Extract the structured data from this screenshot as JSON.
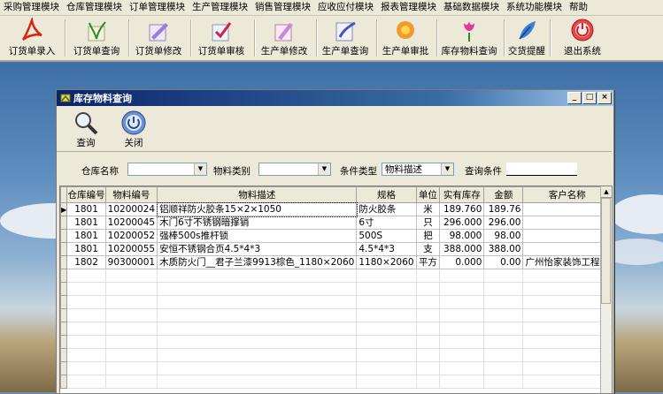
{
  "menu": [
    "采购管理模块",
    "仓库管理模块",
    "订单管理模块",
    "生产管理模块",
    "销售管理模块",
    "应收应付模块",
    "报表管理模块",
    "基础数据模块",
    "系统功能模块",
    "帮助"
  ],
  "toolbar": [
    {
      "label": "订货单录入",
      "icon": "pdf-icon"
    },
    {
      "label": "订货单查询",
      "icon": "plant-icon"
    },
    {
      "label": "订货单修改",
      "icon": "pen-icon"
    },
    {
      "label": "订货单审核",
      "icon": "check-icon"
    },
    {
      "label": "生产单修改",
      "icon": "edit-icon"
    },
    {
      "label": "生产单查询",
      "icon": "search-doc-icon"
    },
    {
      "label": "生产单审批",
      "icon": "flower-icon"
    },
    {
      "label": "库存物料查询",
      "icon": "tulip-icon"
    },
    {
      "label": "交货提醒",
      "icon": "feather-icon"
    },
    {
      "label": "退出系统",
      "icon": "exit-icon"
    }
  ],
  "window": {
    "title": "库存物料查询",
    "controls": [
      "_",
      "□",
      "×"
    ],
    "query_label": "查询",
    "close_label": "关闭"
  },
  "filter": {
    "warehouse_label": "仓库名称",
    "warehouse_value": "",
    "category_label": "物料类别",
    "category_value": "",
    "condtype_label": "条件类型",
    "condtype_value": "物料描述",
    "cond_label": "查询条件",
    "cond_value": ""
  },
  "grid": {
    "columns": [
      "仓库编号",
      "物料编号",
      "物料描述",
      "规格",
      "单位",
      "实有库存",
      "金额",
      "客户名称"
    ],
    "rows": [
      [
        "1801",
        "10200024",
        "铝顺祥防火胶条15×2×1050",
        "防火胶条",
        "米",
        "189.760",
        "189.76",
        ""
      ],
      [
        "1801",
        "10200045",
        "木门6寸不锈钢暗撑销",
        "6寸",
        "只",
        "296.000",
        "296.00",
        ""
      ],
      [
        "1801",
        "10200052",
        "强棒500s推杆锁",
        "500S",
        "把",
        "98.000",
        "98.00",
        ""
      ],
      [
        "1801",
        "10200055",
        "安恒不锈钢合页4.5*4*3",
        "4.5*4*3",
        "支",
        "388.000",
        "388.00",
        ""
      ],
      [
        "1802",
        "90300001",
        "木质防火门__君子兰漆9913棕色_1180×2060",
        "1180×2060",
        "平方",
        "0.000",
        "0.00",
        "广州怡家装饰工程有"
      ]
    ],
    "selected_row": 0
  }
}
